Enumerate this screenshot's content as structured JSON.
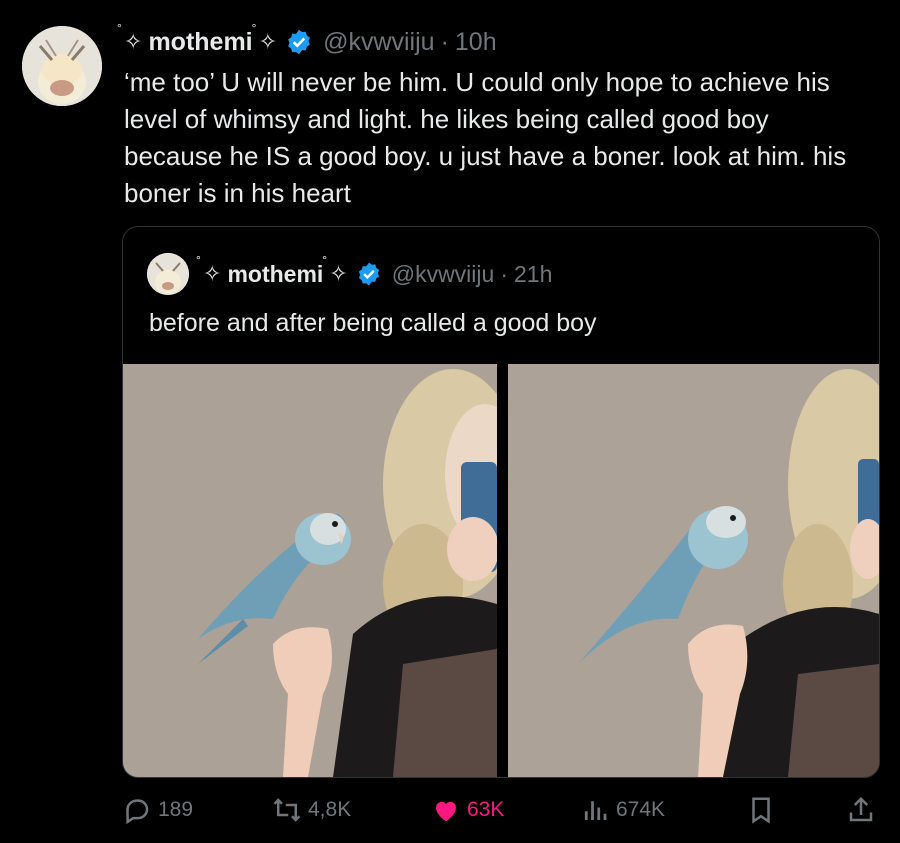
{
  "tweet": {
    "author_name": "mothemi",
    "author_handle": "@kvwviiju",
    "time_sep": "·",
    "time": "10h",
    "text": "‘me too’ U will never be him. U could only hope to achieve his level of whimsy and light. he likes being called good boy because he IS a good boy. u just have a boner. look at him. his boner is in his heart",
    "verified_color": "#1d9bf0"
  },
  "quoted": {
    "author_name": "mothemi",
    "author_handle": "@kvwviiju",
    "time_sep": "·",
    "time": "21h",
    "text": "before and after being called a good boy"
  },
  "actions": {
    "replies": "189",
    "reposts": "4,8K",
    "likes": "63K",
    "views": "674K",
    "like_color": "#f91880",
    "muted_color": "#71767b"
  },
  "icons": [
    "sparkle-icon",
    "verified-badge-icon",
    "reply-icon",
    "repost-icon",
    "heart-icon",
    "views-icon",
    "bookmark-icon",
    "share-icon"
  ]
}
